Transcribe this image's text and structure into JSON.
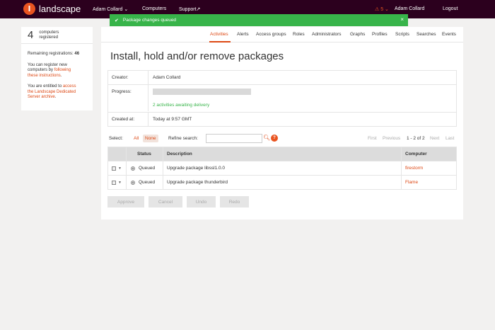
{
  "topbar": {
    "logo_text": "landscape",
    "user_menu": "Adam Collard ⌄",
    "computers": "Computers",
    "support": "Support↗",
    "alerts": "⚠ 5 ⌄",
    "user_name": "Adam Collard",
    "logout": "Logout"
  },
  "toast": {
    "message": "Package changes queued",
    "close": "×",
    "check": "✔"
  },
  "sidebar": {
    "count": "4",
    "count_label_1": "computers",
    "count_label_2": "registered",
    "remaining_label": "Remaining registrations:",
    "remaining_value": "46",
    "register_text_1": "You can register new",
    "register_text_2": "computers by ",
    "register_link_1": "following",
    "register_link_2": "these instructions",
    "register_end": ".",
    "entitled_text": "You are entitled to ",
    "entitled_link_1": "access",
    "entitled_link_2": "the Landscape Dedicated",
    "entitled_link_3": "Server archive",
    "entitled_end": "."
  },
  "tabs": [
    "Activities",
    "Alerts",
    "Access groups",
    "Roles",
    "Administrators",
    "Graphs",
    "Profiles",
    "Scripts",
    "Searches",
    "Events"
  ],
  "active_tab": "Activities",
  "page": {
    "title": "Install, hold and/or remove packages",
    "creator_label": "Creator:",
    "creator_value": "Adam Collard",
    "progress_label": "Progress:",
    "progress_fraction": 0.0,
    "progress_note": "2 activities awaiting delivery",
    "created_label": "Created at:",
    "created_value": "Today at 9:57 GMT"
  },
  "filter": {
    "select_label": "Select:",
    "all": "All",
    "none": "None",
    "refine_label": "Refine search:",
    "refine_value": "",
    "help": "?",
    "first": "First",
    "previous": "Previous",
    "count": "1 - 2 of 2",
    "next": "Next",
    "last": "Last"
  },
  "table": {
    "headers": {
      "status": "Status",
      "description": "Description",
      "computer": "Computer"
    },
    "rows": [
      {
        "status": "Queued",
        "description": "Upgrade package libssl1.0.0",
        "computer": "firestorm"
      },
      {
        "status": "Queued",
        "description": "Upgrade package thunderbird",
        "computer": "Flame"
      }
    ]
  },
  "actions": {
    "approve": "Approve",
    "cancel": "Cancel",
    "undo": "Undo",
    "redo": "Redo"
  },
  "colors": {
    "header_bg": "#2c001e",
    "accent": "#dd4814",
    "success": "#38b44a"
  }
}
